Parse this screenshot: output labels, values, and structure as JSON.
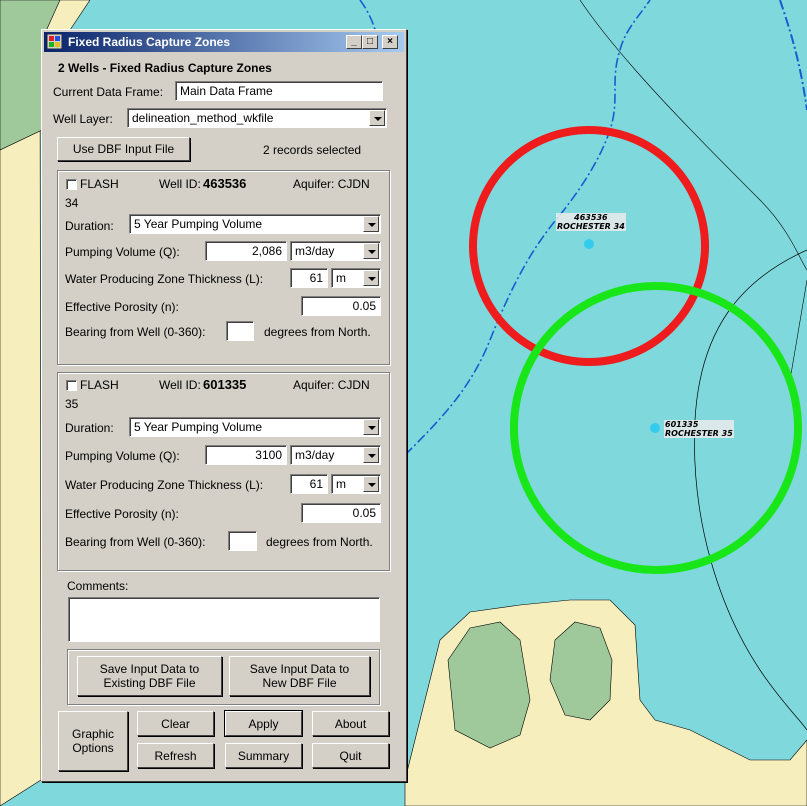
{
  "window": {
    "title": "Fixed Radius Capture Zones",
    "heading": "2 Wells - Fixed Radius Capture Zones"
  },
  "top": {
    "data_frame_label": "Current Data Frame:",
    "data_frame_value": "Main Data Frame",
    "well_layer_label": "Well Layer:",
    "well_layer_value": "delineation_method_wkfile",
    "dbf_button": "Use DBF Input File",
    "records_status": "2 records selected"
  },
  "wells": [
    {
      "flash": "FLASH",
      "well_id_label": "Well ID:",
      "well_id": "463536",
      "aquifer": "Aquifer:  CJDN",
      "number": "34",
      "duration_label": "Duration:",
      "duration": "5 Year Pumping Volume",
      "pumping_label": "Pumping Volume (Q):",
      "pumping": "2,086",
      "pumping_unit": "m3/day",
      "thickness_label": "Water Producing Zone Thickness (L):",
      "thickness": "61",
      "thickness_unit": "m",
      "porosity_label": "Effective Porosity (n):",
      "porosity": "0.05",
      "bearing_label": "Bearing from Well (0-360):",
      "bearing": "",
      "bearing_suffix": "degrees from North."
    },
    {
      "flash": "FLASH",
      "well_id_label": "Well ID:",
      "well_id": "601335",
      "aquifer": "Aquifer:  CJDN",
      "number": "35",
      "duration_label": "Duration:",
      "duration": "5 Year Pumping Volume",
      "pumping_label": "Pumping Volume (Q):",
      "pumping": "3100",
      "pumping_unit": "m3/day",
      "thickness_label": "Water Producing Zone Thickness (L):",
      "thickness": "61",
      "thickness_unit": "m",
      "porosity_label": "Effective Porosity (n):",
      "porosity": "0.05",
      "bearing_label": "Bearing from Well (0-360):",
      "bearing": "",
      "bearing_suffix": "degrees from North."
    }
  ],
  "comments": {
    "label": "Comments:",
    "value": ""
  },
  "save": {
    "existing": "Save Input Data to Existing DBF File",
    "new": "Save Input Data to New DBF File"
  },
  "buttons": {
    "graphic": "Graphic Options",
    "clear": "Clear",
    "apply": "Apply",
    "about": "About",
    "refresh": "Refresh",
    "summary": "Summary",
    "quit": "Quit"
  },
  "map": {
    "labels": [
      {
        "id": "463536",
        "name": "ROCHESTER 34"
      },
      {
        "id": "601335",
        "name": "ROCHESTER 35"
      }
    ],
    "colors": {
      "water": "#7fd8dc",
      "land": "#f6efbd",
      "green_area": "#9fc99a",
      "zone_1": "#ee1c1c",
      "zone_2": "#19e619",
      "well_point": "#33ccee",
      "stream": "#1a5ccf"
    }
  }
}
